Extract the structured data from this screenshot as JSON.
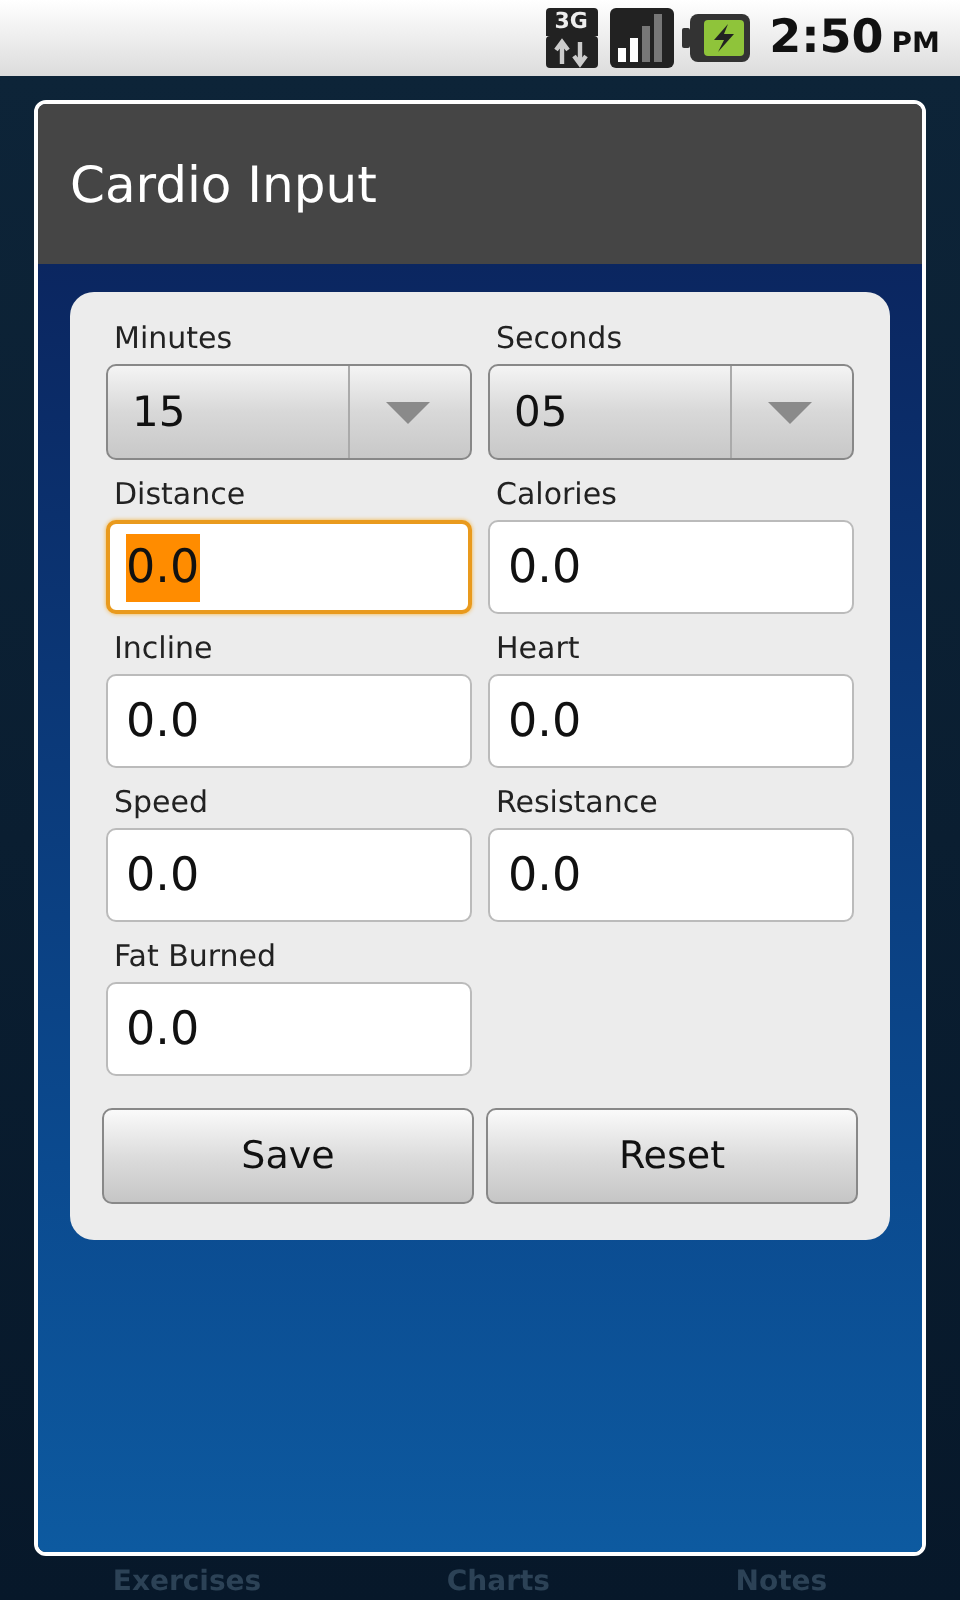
{
  "status_bar": {
    "network": "3G",
    "time": "2:50",
    "ampm": "PM"
  },
  "background": {
    "tabs": [
      {
        "label": "Exercises",
        "selected": false
      },
      {
        "label": "Charts",
        "selected": false
      },
      {
        "label": "Notes",
        "selected": false
      }
    ]
  },
  "dialog": {
    "title": "Cardio Input",
    "fields": [
      {
        "kind": "spinner",
        "label": "Minutes",
        "value": "15"
      },
      {
        "kind": "spinner",
        "label": "Seconds",
        "value": "05"
      },
      {
        "kind": "input",
        "label": "Distance",
        "value": "0.0",
        "focused": true
      },
      {
        "kind": "input",
        "label": "Calories",
        "value": "0.0",
        "focused": false
      },
      {
        "kind": "input",
        "label": "Incline",
        "value": "0.0",
        "focused": false
      },
      {
        "kind": "input",
        "label": "Heart",
        "value": "0.0",
        "focused": false
      },
      {
        "kind": "input",
        "label": "Speed",
        "value": "0.0",
        "focused": false
      },
      {
        "kind": "input",
        "label": "Resistance",
        "value": "0.0",
        "focused": false
      },
      {
        "kind": "input",
        "label": "Fat Burned",
        "value": "0.0",
        "focused": false
      }
    ],
    "buttons": [
      "Save",
      "Reset"
    ]
  }
}
